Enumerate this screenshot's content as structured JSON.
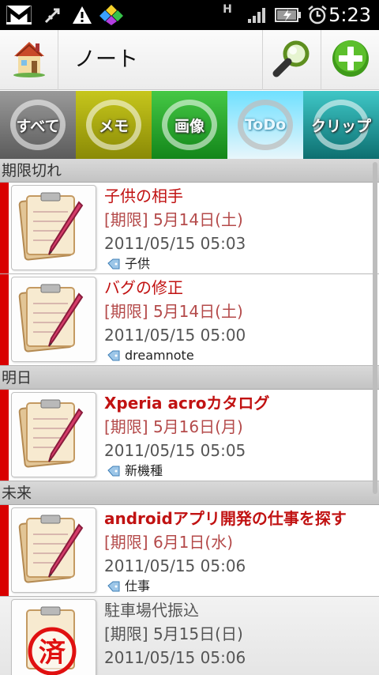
{
  "status_bar": {
    "time": "5:23",
    "network": "H",
    "icons": [
      "gmail-icon",
      "usb-debug-icon",
      "warning-icon",
      "app-diamond-icon",
      "signal-icon",
      "battery-charging-icon",
      "alarm-icon"
    ]
  },
  "header": {
    "title": "ノート",
    "icons": [
      "home-house-icon",
      "search-icon",
      "add-icon"
    ]
  },
  "tabs": [
    {
      "label": "すべて",
      "color": "#7a7a7a"
    },
    {
      "label": "メモ",
      "color": "#b5b510"
    },
    {
      "label": "画像",
      "color": "#2fb02f"
    },
    {
      "label": "ToDo",
      "color": "#6fe0ff",
      "selected": true
    },
    {
      "label": "クリップ",
      "color": "#2aa6a6"
    }
  ],
  "sections": [
    {
      "label": "期限切れ",
      "items": [
        {
          "title": "子供の相手",
          "due": "[期限] 5月14日(土)",
          "date": "2011/05/15 05:03",
          "tag": "子供",
          "bold": false
        },
        {
          "title": "バグの修正",
          "due": "[期限] 5月14日(土)",
          "date": "2011/05/15 05:00",
          "tag": "dreamnote",
          "bold": false
        }
      ]
    },
    {
      "label": "明日",
      "items": [
        {
          "title": "Xperia acroカタログ",
          "due": "[期限] 5月16日(月)",
          "date": "2011/05/15 05:05",
          "tag": "新機種",
          "bold": true
        }
      ]
    },
    {
      "label": "未来",
      "items": [
        {
          "title": "androidアプリ開発の仕事を探す",
          "due": "[期限] 6月1日(水)",
          "date": "2011/05/15 05:06",
          "tag": "仕事",
          "bold": true
        },
        {
          "title": "駐車場代振込",
          "due": "[期限] 5月15日(日)",
          "date": "2011/05/15 05:06",
          "completed": true
        }
      ]
    }
  ],
  "done_stamp": "済",
  "colors": {
    "overdue_marker": "#d90000",
    "title_text": "#c11212"
  }
}
